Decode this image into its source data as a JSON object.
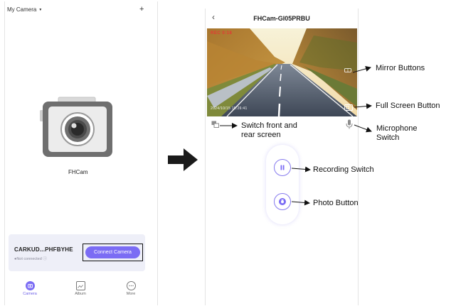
{
  "left_phone": {
    "header": {
      "title": "My Camera",
      "add_icon": "plus-icon"
    },
    "camera": {
      "name": "FHCam"
    },
    "device_card": {
      "name": "CARKUD...PHFBYHE",
      "status": "●Not connected ⓘ",
      "connect_label": "Connect Camera"
    },
    "tabs": [
      {
        "label": "Camera",
        "icon": "camera-tab-icon"
      },
      {
        "label": "Album",
        "icon": "album-icon"
      },
      {
        "label": "More",
        "icon": "more-icon"
      }
    ]
  },
  "right_phone": {
    "header": {
      "title": "FHCam-GI05PRBU",
      "back_icon": "back-chevron-icon"
    },
    "video": {
      "rec_label": "REC  0:18",
      "timestamp": "2024/10/15  15:26:41"
    }
  },
  "annotations": {
    "mirror": "Mirror Buttons",
    "fullscreen": "Full Screen Button",
    "switch_line1": "Switch front and",
    "switch_line2": "rear screen",
    "mic_line1": "Microphone",
    "mic_line2": "Switch",
    "recording": "Recording Switch",
    "photo": "Photo Button"
  },
  "colors": {
    "accent": "#7b6cf4",
    "accent_light": "#eeeff8",
    "recording_text": "#e53935"
  }
}
